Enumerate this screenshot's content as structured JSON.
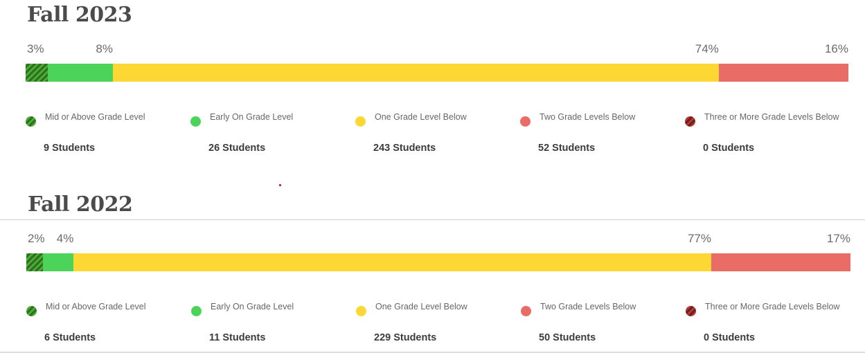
{
  "colors": {
    "mid_or_above": "#4caf35",
    "early_on": "#4cd45a",
    "one_below": "#fdd835",
    "two_below": "#e96d66",
    "three_or_more": "#b53a35",
    "stripe_dark": "#2e6f22"
  },
  "chart_data": [
    {
      "type": "bar",
      "orientation": "horizontal-stacked",
      "title": "Fall 2023",
      "xlim": [
        0,
        330
      ],
      "series": [
        {
          "name": "Mid or Above Grade Level",
          "value": 9,
          "percent_label": "3%",
          "color_key": "mid_or_above",
          "pattern": "striped"
        },
        {
          "name": "Early On Grade Level",
          "value": 26,
          "percent_label": "8%",
          "color_key": "early_on",
          "pattern": "solid"
        },
        {
          "name": "One Grade Level Below",
          "value": 243,
          "percent_label": "74%",
          "color_key": "one_below",
          "pattern": "solid"
        },
        {
          "name": "Two Grade Levels Below",
          "value": 52,
          "percent_label": "16%",
          "color_key": "two_below",
          "pattern": "solid"
        },
        {
          "name": "Three or More Grade Levels Below",
          "value": 0,
          "percent_label": "",
          "color_key": "three_or_more",
          "pattern": "striped"
        }
      ],
      "legend": [
        {
          "label": "Mid or Above Grade Level",
          "count": "9 Students",
          "color_key": "mid_or_above",
          "pattern": "striped"
        },
        {
          "label": "Early On Grade Level",
          "count": "26 Students",
          "color_key": "early_on",
          "pattern": "solid"
        },
        {
          "label": "One Grade Level Below",
          "count": "243 Students",
          "color_key": "one_below",
          "pattern": "solid"
        },
        {
          "label": "Two Grade Levels Below",
          "count": "52 Students",
          "color_key": "two_below",
          "pattern": "solid"
        },
        {
          "label": "Three or More Grade Levels Below",
          "count": "0 Students",
          "color_key": "three_or_more",
          "pattern": "striped"
        }
      ],
      "legend_placement": "bottom"
    },
    {
      "type": "bar",
      "orientation": "horizontal-stacked",
      "title": "Fall 2022",
      "xlim": [
        0,
        296
      ],
      "series": [
        {
          "name": "Mid or Above Grade Level",
          "value": 6,
          "percent_label": "2%",
          "color_key": "mid_or_above",
          "pattern": "striped"
        },
        {
          "name": "Early On Grade Level",
          "value": 11,
          "percent_label": "4%",
          "color_key": "early_on",
          "pattern": "solid"
        },
        {
          "name": "One Grade Level Below",
          "value": 229,
          "percent_label": "77%",
          "color_key": "one_below",
          "pattern": "solid"
        },
        {
          "name": "Two Grade Levels Below",
          "value": 50,
          "percent_label": "17%",
          "color_key": "two_below",
          "pattern": "solid"
        },
        {
          "name": "Three or More Grade Levels Below",
          "value": 0,
          "percent_label": "",
          "color_key": "three_or_more",
          "pattern": "striped"
        }
      ],
      "legend": [
        {
          "label": "Mid or Above Grade Level",
          "count": "6 Students",
          "color_key": "mid_or_above",
          "pattern": "striped"
        },
        {
          "label": "Early On Grade Level",
          "count": "11 Students",
          "color_key": "early_on",
          "pattern": "solid"
        },
        {
          "label": "One Grade Level Below",
          "count": "229 Students",
          "color_key": "one_below",
          "pattern": "solid"
        },
        {
          "label": "Two Grade Levels Below",
          "count": "50 Students",
          "color_key": "two_below",
          "pattern": "solid"
        },
        {
          "label": "Three or More Grade Levels Below",
          "count": "0 Students",
          "color_key": "three_or_more",
          "pattern": "striped"
        }
      ],
      "legend_placement": "bottom"
    }
  ]
}
